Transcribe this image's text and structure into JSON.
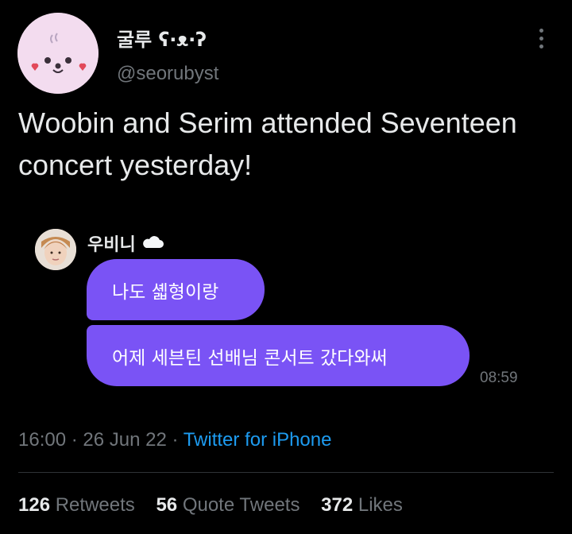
{
  "tweet": {
    "display_name": "굴루 ʕ·ᴥ·ʔ",
    "handle": "@seorubyst",
    "text": "Woobin and Serim attended Seventeen concert yesterday!"
  },
  "chat": {
    "sender": "우비니",
    "messages": [
      "나도 셻형이랑",
      "어제 세븐틴 선배님 콘서트 갔다와써"
    ],
    "time": "08:59"
  },
  "meta": {
    "time": "16:00",
    "date": "26 Jun 22",
    "source": "Twitter for iPhone",
    "separator": " · "
  },
  "stats": {
    "retweets_count": "126",
    "retweets_label": "Retweets",
    "quotes_count": "56",
    "quotes_label": "Quote Tweets",
    "likes_count": "372",
    "likes_label": "Likes"
  },
  "icons": {
    "avatar": "seal-face-avatar",
    "more": "more-options-icon",
    "cloud": "cloud-icon"
  }
}
